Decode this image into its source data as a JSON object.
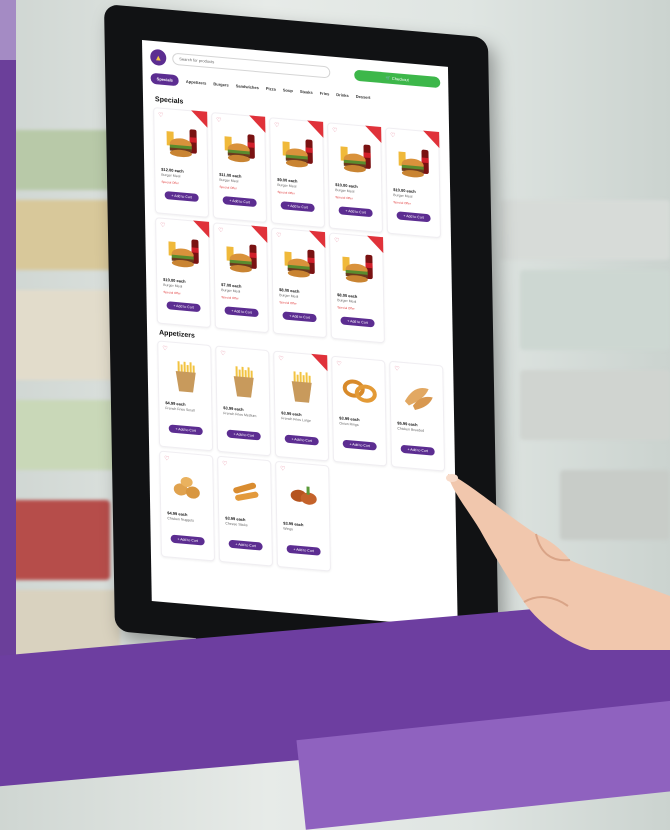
{
  "header": {
    "search_placeholder": "Search for products",
    "checkout_label": "Checkout"
  },
  "categories": [
    {
      "label": "Specials",
      "active": true
    },
    {
      "label": "Appetizers",
      "active": false
    },
    {
      "label": "Burgers",
      "active": false
    },
    {
      "label": "Sandwiches",
      "active": false
    },
    {
      "label": "Pizza",
      "active": false
    },
    {
      "label": "Soup",
      "active": false
    },
    {
      "label": "Steaks",
      "active": false
    },
    {
      "label": "Fries",
      "active": false
    },
    {
      "label": "Drinks",
      "active": false
    },
    {
      "label": "Dessert",
      "active": false
    }
  ],
  "sections": [
    {
      "title": "Specials",
      "items": [
        {
          "price": "$12.00 each",
          "name": "Burger Meal",
          "tag": "Special Offer",
          "icon": "burger-fries-drink",
          "ribbon": true
        },
        {
          "price": "$11.00 each",
          "name": "Burger Meal",
          "tag": "Special Offer",
          "icon": "burger-fries-drink",
          "ribbon": true
        },
        {
          "price": "$9.00 each",
          "name": "Burger Meal",
          "tag": "Special Offer",
          "icon": "burger-fries-drink",
          "ribbon": true
        },
        {
          "price": "$10.00 each",
          "name": "Burger Meal",
          "tag": "Special Offer",
          "icon": "burger-fries-drink",
          "ribbon": true
        },
        {
          "price": "$10.00 each",
          "name": "Burger Meal",
          "tag": "Special Offer",
          "icon": "burger-fries-drink",
          "ribbon": true
        },
        {
          "price": "$10.00 each",
          "name": "Burger Meal",
          "tag": "Special Offer",
          "icon": "burger-fries-drink",
          "ribbon": true
        },
        {
          "price": "$7.00 each",
          "name": "Burger Meal",
          "tag": "Special Offer",
          "icon": "burger-fries-drink",
          "ribbon": true
        },
        {
          "price": "$8.00 each",
          "name": "Burger Meal",
          "tag": "Special Offer",
          "icon": "burger-fries-drink",
          "ribbon": true
        },
        {
          "price": "$8.00 each",
          "name": "Burger Meal",
          "tag": "Special Offer",
          "icon": "burger-fries-drink",
          "ribbon": true
        }
      ]
    },
    {
      "title": "Appetizers",
      "items": [
        {
          "price": "$4.99 each",
          "name": "French Fries Small",
          "tag": "",
          "icon": "fries",
          "ribbon": false
        },
        {
          "price": "$3.99 each",
          "name": "French Fries Medium",
          "tag": "",
          "icon": "fries",
          "ribbon": false
        },
        {
          "price": "$3.99 each",
          "name": "French Fries Large",
          "tag": "",
          "icon": "fries",
          "ribbon": true
        },
        {
          "price": "$3.99 each",
          "name": "Onion Rings",
          "tag": "",
          "icon": "onion-rings",
          "ribbon": false
        },
        {
          "price": "$5.99 each",
          "name": "Chicken Breaded",
          "tag": "",
          "icon": "breaded",
          "ribbon": false
        },
        {
          "price": "$4.99 each",
          "name": "Chicken Nuggets",
          "tag": "",
          "icon": "nuggets",
          "ribbon": false
        },
        {
          "price": "$3.99 each",
          "name": "Cheese Sticks",
          "tag": "",
          "icon": "sticks",
          "ribbon": false
        },
        {
          "price": "$3.99 each",
          "name": "Wings",
          "tag": "",
          "icon": "wings",
          "ribbon": false
        }
      ]
    }
  ],
  "add_label": "+ Add to Cart",
  "colors": {
    "brand": "#5c2d91",
    "checkout": "#3db74a",
    "ribbon": "#e0323a",
    "frame_purple": "#6d3ea0"
  }
}
